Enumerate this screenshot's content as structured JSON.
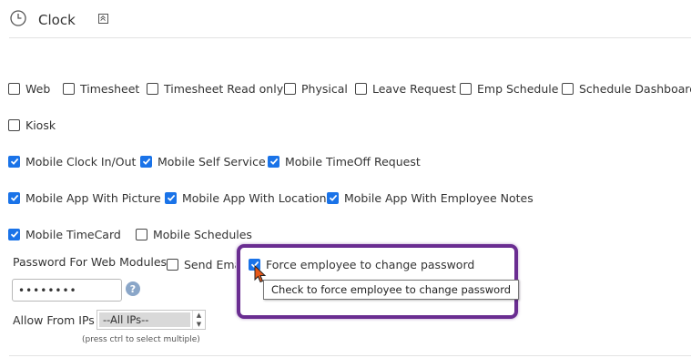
{
  "header": {
    "title": "Clock",
    "clock_icon": "clock-icon",
    "collapse_icon": "collapse-up-icon"
  },
  "colors": {
    "checkbox_checked": "#1a73e8",
    "highlight_border": "#6a2d91",
    "cursor": "#e8591a"
  },
  "modules": {
    "web": {
      "label": "Web",
      "checked": false
    },
    "timesheet": {
      "label": "Timesheet",
      "checked": false
    },
    "timesheet_read_only": {
      "label": "Timesheet Read only",
      "checked": false
    },
    "physical": {
      "label": "Physical",
      "checked": false
    },
    "leave_request": {
      "label": "Leave Request",
      "checked": false
    },
    "emp_schedule": {
      "label": "Emp Schedule",
      "checked": false
    },
    "schedule_dashboard": {
      "label": "Schedule Dashboard",
      "checked": false
    },
    "kiosk": {
      "label": "Kiosk",
      "checked": false
    },
    "mobile_clock": {
      "label": "Mobile Clock In/Out",
      "checked": true
    },
    "mobile_self_service": {
      "label": "Mobile Self Service",
      "checked": true
    },
    "mobile_timeoff": {
      "label": "Mobile TimeOff Request",
      "checked": true
    },
    "mobile_app_picture": {
      "label": "Mobile App With Picture",
      "checked": true
    },
    "mobile_app_location": {
      "label": "Mobile App With Location",
      "checked": true
    },
    "mobile_app_notes": {
      "label": "Mobile App With Employee Notes",
      "checked": true
    },
    "mobile_timecard": {
      "label": "Mobile TimeCard",
      "checked": true
    },
    "mobile_schedules": {
      "label": "Mobile Schedules",
      "checked": false
    }
  },
  "password": {
    "label": "Password For Web Modules",
    "value": "••••••••",
    "help_icon": "help-icon",
    "send_email": {
      "label": "Send Ema",
      "checked": false
    },
    "force_change": {
      "label": "Force employee to change password",
      "checked": true
    },
    "tooltip": "Check to force employee to change password"
  },
  "allow_ips": {
    "label": "Allow From IPs",
    "selected": "--All IPs--",
    "hint": "(press ctrl to select multiple)"
  }
}
